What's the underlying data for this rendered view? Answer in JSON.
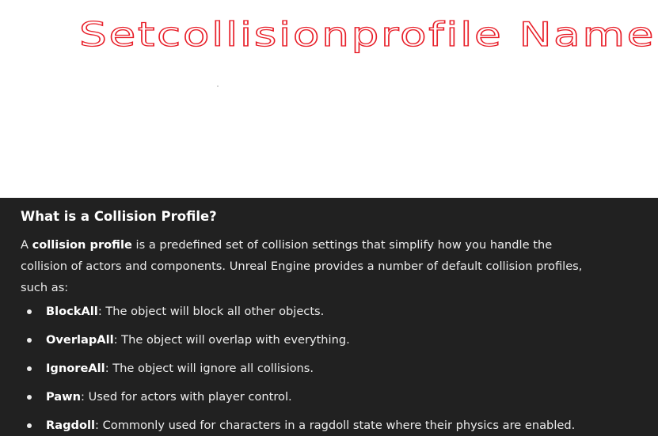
{
  "handwriting": {
    "text": "Setcollisionprofile Name",
    "color": "#e8202a"
  },
  "panel": {
    "background": "#212121",
    "heading": "What is a Collision Profile?",
    "intro": {
      "pre": "A ",
      "bold": "collision profile",
      "post": " is a predefined set of collision settings that simplify how you handle the collision of actors and components. Unreal Engine provides a number of default collision profiles, such as:"
    },
    "items": [
      {
        "term": "BlockAll",
        "desc": ": The object will block all other objects."
      },
      {
        "term": "OverlapAll",
        "desc": ": The object will overlap with everything."
      },
      {
        "term": "IgnoreAll",
        "desc": ": The object will ignore all collisions."
      },
      {
        "term": "Pawn",
        "desc": ": Used for actors with player control."
      },
      {
        "term": "Ragdoll",
        "desc": ": Commonly used for characters in a ragdoll state where their physics are enabled."
      }
    ]
  }
}
